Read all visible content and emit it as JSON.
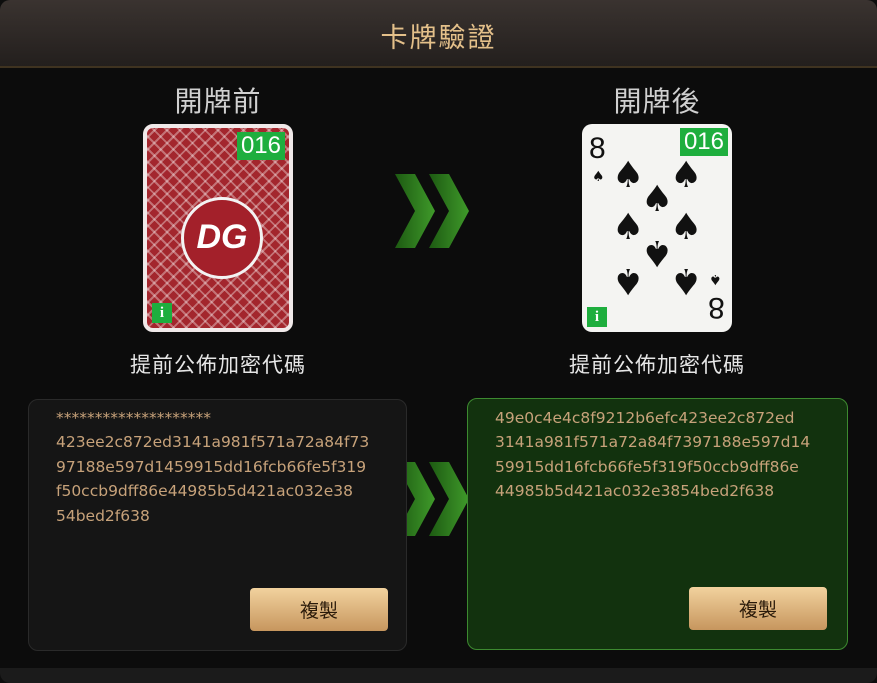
{
  "dialog": {
    "title": "卡牌驗證"
  },
  "before": {
    "heading": "開牌前",
    "card_number": "016",
    "card_logo": "DG",
    "info_badge": "i",
    "caption": "提前公佈加密代碼",
    "hash_lines": [
      "********************",
      "423ee2c872ed3141a981f571a72a84f73",
      "97188e597d1459915dd16fcb66fe5f319",
      "f50ccb9dff86e44985b5d421ac032e38",
      "54bed2f638"
    ],
    "copy_label": "複製"
  },
  "after": {
    "heading": "開牌後",
    "card_number": "016",
    "card_rank": "8",
    "card_suit": "♠",
    "info_badge": "i",
    "caption": "提前公佈加密代碼",
    "hash_lines": [
      "49e0c4e4c8f9212b6efc423ee2c872ed",
      "3141a981f571a72a84f7397188e597d14",
      "59915dd16fcb66fe5f319f50ccb9dff86e",
      "44985b5d421ac032e3854bed2f638"
    ],
    "copy_label": "複製"
  },
  "colors": {
    "accent_gold": "#e4c08a",
    "hash_text": "#c7a27a",
    "verified_green": "#1eae3e",
    "chevron_green": "#2f7a1f",
    "card_back_red": "#a3262d"
  }
}
